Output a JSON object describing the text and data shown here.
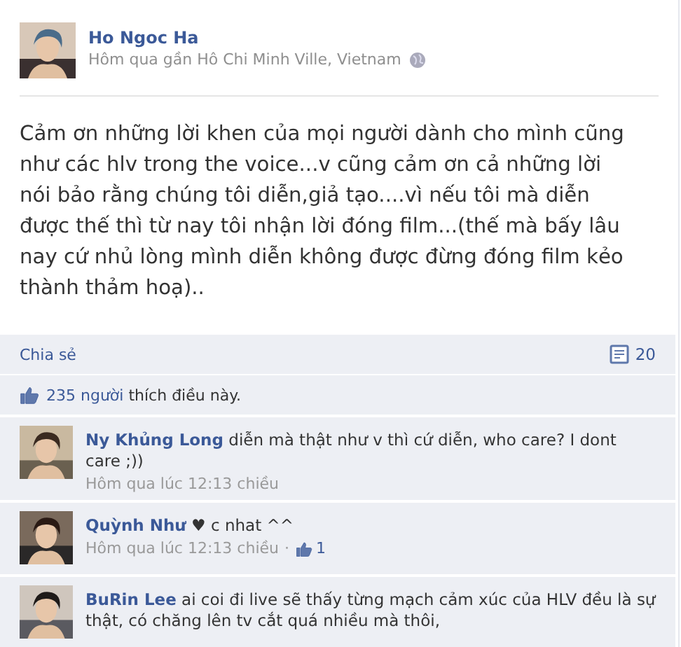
{
  "post": {
    "author": "Ho Ngoc Ha",
    "meta": "Hôm qua gần Hô Chi Minh Ville, Vietnam",
    "text": "Cảm ơn những lời khen của mọi người dành cho mình cũng như các hlv trong the voice...v cũng cảm ơn cả những lời nói bảo rằng chúng tôi diễn,giả tạo....vì nếu tôi mà diễn được thế thì từ nay tôi nhận lời đóng film...(thế mà bấy lâu nay cứ nhủ lòng mình diễn không được đừng đóng film kẻo thành thảm hoạ).."
  },
  "actions": {
    "share": "Chia sẻ",
    "comment_count": "20"
  },
  "likes": {
    "count": "235",
    "people": "người",
    "rest": "thích điều này."
  },
  "comments": [
    {
      "name": "Ny Khủng Long",
      "text": "diễn mà thật như v thì cứ diễn, who care? I dont care ;))",
      "time": "Hôm qua lúc 12:13 chiều"
    },
    {
      "name": "Quỳnh Như",
      "text": "♥ c nhat ^^",
      "time": "Hôm qua lúc 12:13 chiều",
      "separator": "·",
      "likes": "1"
    },
    {
      "name": "BuRin Lee",
      "text": "ai coi đi live sẽ thấy từng mạch cảm xúc của HLV đều là sự thật, có chăng lên tv cắt quá nhiều mà thôi,"
    }
  ]
}
